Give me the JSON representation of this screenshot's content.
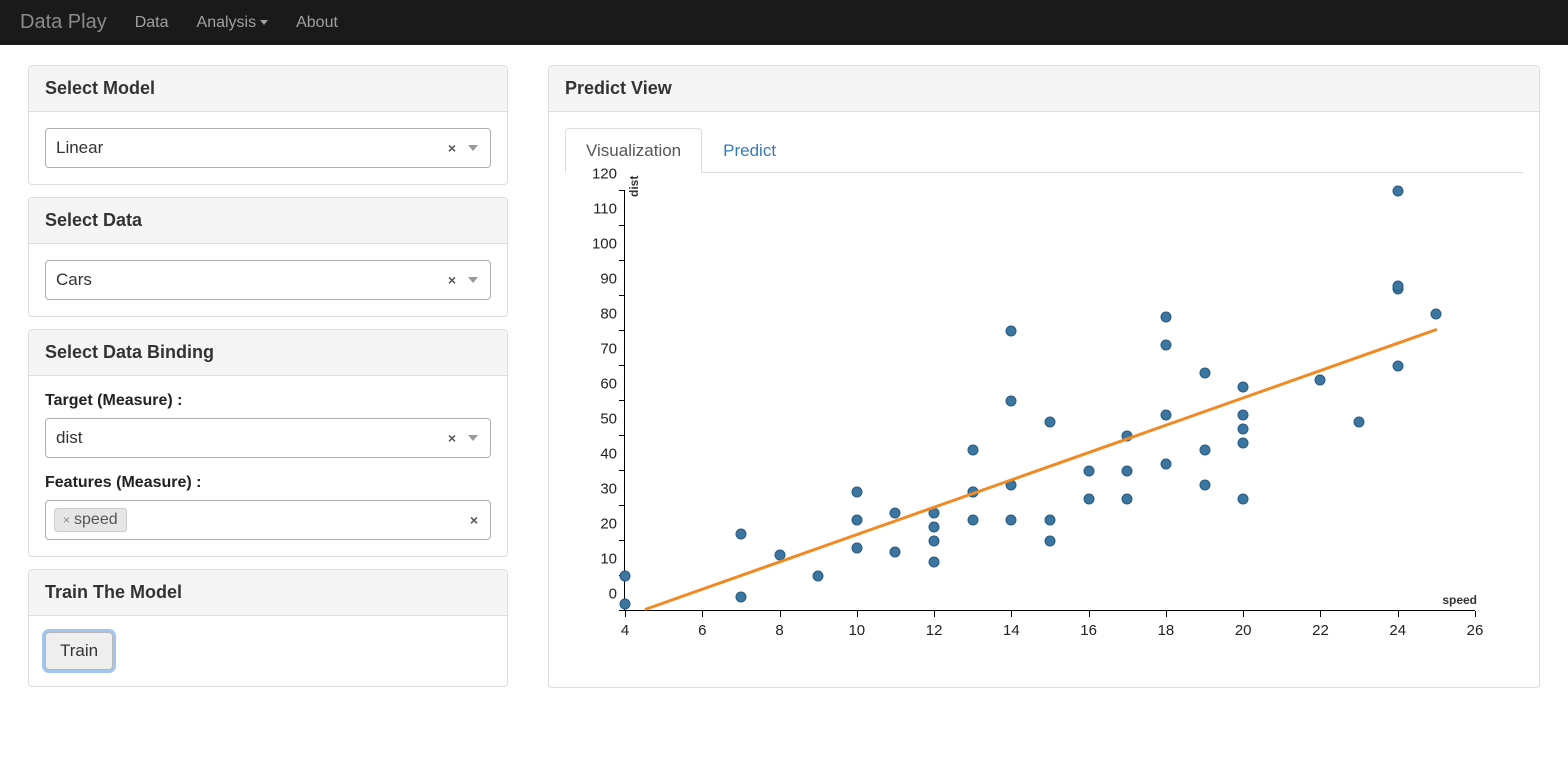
{
  "navbar": {
    "brand": "Data Play",
    "links": [
      "Data",
      "Analysis",
      "About"
    ],
    "dropdown_index": 1
  },
  "panels": {
    "model": {
      "title": "Select Model",
      "value": "Linear"
    },
    "data": {
      "title": "Select Data",
      "value": "Cars"
    },
    "binding": {
      "title": "Select Data Binding",
      "target_label": "Target (Measure) :",
      "target_value": "dist",
      "features_label": "Features (Measure) :",
      "features": [
        "speed"
      ]
    },
    "train": {
      "title": "Train The Model",
      "button": "Train"
    }
  },
  "predict": {
    "title": "Predict View",
    "tabs": [
      "Visualization",
      "Predict"
    ],
    "active_tab": 0
  },
  "chart_data": {
    "type": "scatter",
    "xlabel": "speed",
    "ylabel": "dist",
    "xlim": [
      4,
      26
    ],
    "ylim": [
      0,
      120
    ],
    "x_ticks": [
      4,
      6,
      8,
      10,
      12,
      14,
      16,
      18,
      20,
      22,
      24,
      26
    ],
    "y_ticks": [
      0,
      10,
      20,
      30,
      40,
      50,
      60,
      70,
      80,
      90,
      100,
      110,
      120
    ],
    "series": [
      {
        "name": "cars",
        "x_y": [
          [
            4,
            2
          ],
          [
            4,
            10
          ],
          [
            7,
            4
          ],
          [
            7,
            22
          ],
          [
            8,
            16
          ],
          [
            9,
            10
          ],
          [
            10,
            18
          ],
          [
            10,
            26
          ],
          [
            10,
            34
          ],
          [
            11,
            17
          ],
          [
            11,
            28
          ],
          [
            12,
            14
          ],
          [
            12,
            20
          ],
          [
            12,
            24
          ],
          [
            12,
            28
          ],
          [
            13,
            26
          ],
          [
            13,
            34
          ],
          [
            13,
            34
          ],
          [
            13,
            46
          ],
          [
            14,
            26
          ],
          [
            14,
            36
          ],
          [
            14,
            60
          ],
          [
            14,
            80
          ],
          [
            15,
            20
          ],
          [
            15,
            26
          ],
          [
            15,
            54
          ],
          [
            16,
            32
          ],
          [
            16,
            40
          ],
          [
            17,
            32
          ],
          [
            17,
            40
          ],
          [
            17,
            50
          ],
          [
            18,
            42
          ],
          [
            18,
            56
          ],
          [
            18,
            76
          ],
          [
            18,
            84
          ],
          [
            19,
            36
          ],
          [
            19,
            46
          ],
          [
            19,
            68
          ],
          [
            20,
            32
          ],
          [
            20,
            48
          ],
          [
            20,
            52
          ],
          [
            20,
            56
          ],
          [
            20,
            64
          ],
          [
            22,
            66
          ],
          [
            23,
            54
          ],
          [
            24,
            70
          ],
          [
            24,
            92
          ],
          [
            24,
            93
          ],
          [
            24,
            120
          ],
          [
            25,
            85
          ]
        ]
      }
    ],
    "regression": {
      "x1": 4,
      "y1": -2,
      "x2": 25,
      "y2": 80
    }
  }
}
